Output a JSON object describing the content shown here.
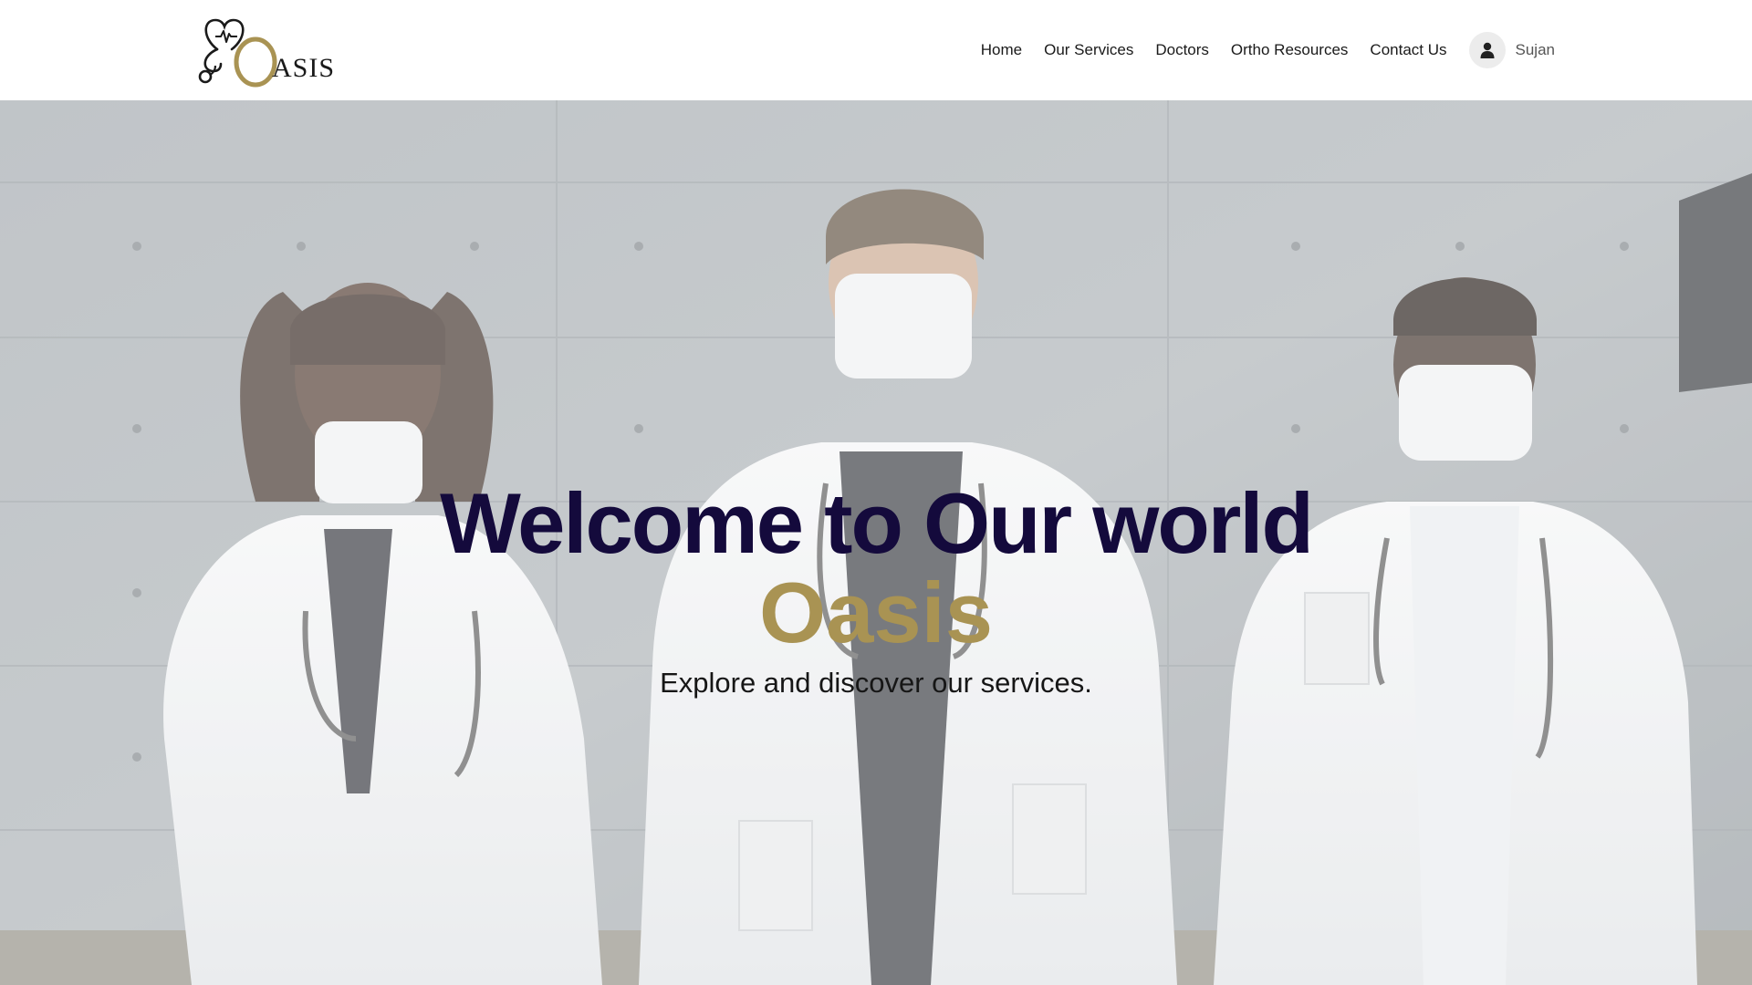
{
  "header": {
    "logo": {
      "wordmark": "OASIS",
      "icons": [
        "heart-icon",
        "stethoscope-icon"
      ],
      "colors": {
        "dark": "#1a1a1a",
        "gold": "#a99353"
      }
    },
    "nav": {
      "home": "Home",
      "services": "Our Services",
      "doctors": "Doctors",
      "resources": "Ortho Resources",
      "contact": "Contact Us"
    },
    "user": {
      "name": "Sujan",
      "icon": "user-icon"
    }
  },
  "hero": {
    "title": "Welcome to Our world",
    "brand": "Oasis",
    "subtitle": "Explore and discover our services.",
    "background": "three masked doctors in white coats with stethoscopes against a concrete wall",
    "colors": {
      "title": "#140a3c",
      "brand": "#a99353",
      "subtitle": "#161616"
    }
  }
}
